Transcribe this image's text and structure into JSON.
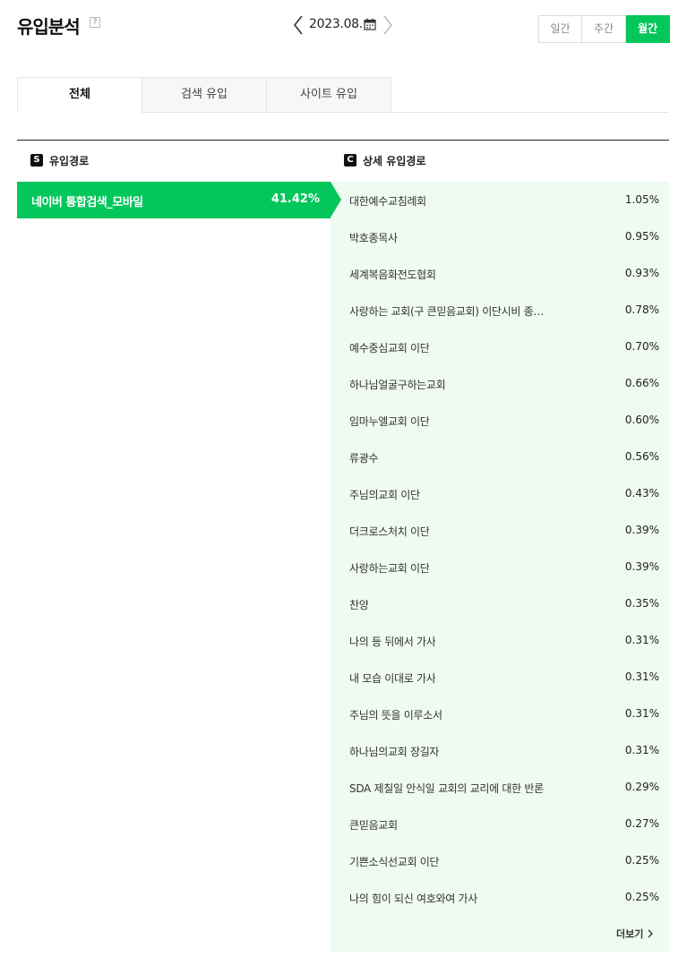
{
  "header": {
    "title": "유입분석",
    "help": "?"
  },
  "date_nav": {
    "label": "2023.08.",
    "prev_icon": "chevron-left-icon",
    "next_icon": "chevron-right-icon",
    "calendar_icon": "calendar-icon"
  },
  "period": {
    "daily": "일간",
    "weekly": "주간",
    "monthly": "월간",
    "selected": "monthly",
    "accent": "#03c75a"
  },
  "tabs": [
    {
      "label": "전체",
      "active": true
    },
    {
      "label": "검색 유입",
      "active": false
    },
    {
      "label": "사이트 유입",
      "active": false
    }
  ],
  "columns": {
    "source_badge": "S",
    "source_label": "유입경로",
    "detail_badge": "C",
    "detail_label": "상세 유입경로"
  },
  "source": {
    "name": "네이버 통합검색_모바일",
    "percent": "41.42%"
  },
  "details": [
    {
      "label": "대한예수교침례회",
      "percent": "1.05%"
    },
    {
      "label": "박호종목사",
      "percent": "0.95%"
    },
    {
      "label": "세계복음화전도협회",
      "percent": "0.93%"
    },
    {
      "label": "사랑하는 교회(구 큰믿음교회) 이단시비 종…",
      "percent": "0.78%"
    },
    {
      "label": "예수중심교회 이단",
      "percent": "0.70%"
    },
    {
      "label": "하나님얼굴구하는교회",
      "percent": "0.66%"
    },
    {
      "label": "임마누엘교회 이단",
      "percent": "0.60%"
    },
    {
      "label": "류광수",
      "percent": "0.56%"
    },
    {
      "label": "주님의교회 이단",
      "percent": "0.43%"
    },
    {
      "label": "더크로스처치 이단",
      "percent": "0.39%"
    },
    {
      "label": "사랑하는교회 이단",
      "percent": "0.39%"
    },
    {
      "label": "찬양",
      "percent": "0.35%"
    },
    {
      "label": "나의 등 뒤에서 가사",
      "percent": "0.31%"
    },
    {
      "label": "내 모습 이대로 가사",
      "percent": "0.31%"
    },
    {
      "label": "주님의 뜻을 이루소서",
      "percent": "0.31%"
    },
    {
      "label": "하나님의교회 장길자",
      "percent": "0.31%"
    },
    {
      "label": "SDA 제칠일 안식일 교회의 교리에 대한 반론",
      "percent": "0.29%"
    },
    {
      "label": "큰믿음교회",
      "percent": "0.27%"
    },
    {
      "label": "기쁜소식선교회 이단",
      "percent": "0.25%"
    },
    {
      "label": "나의 힘이 되신 여호와여 가사",
      "percent": "0.25%"
    }
  ],
  "more": {
    "label": "더보기"
  }
}
